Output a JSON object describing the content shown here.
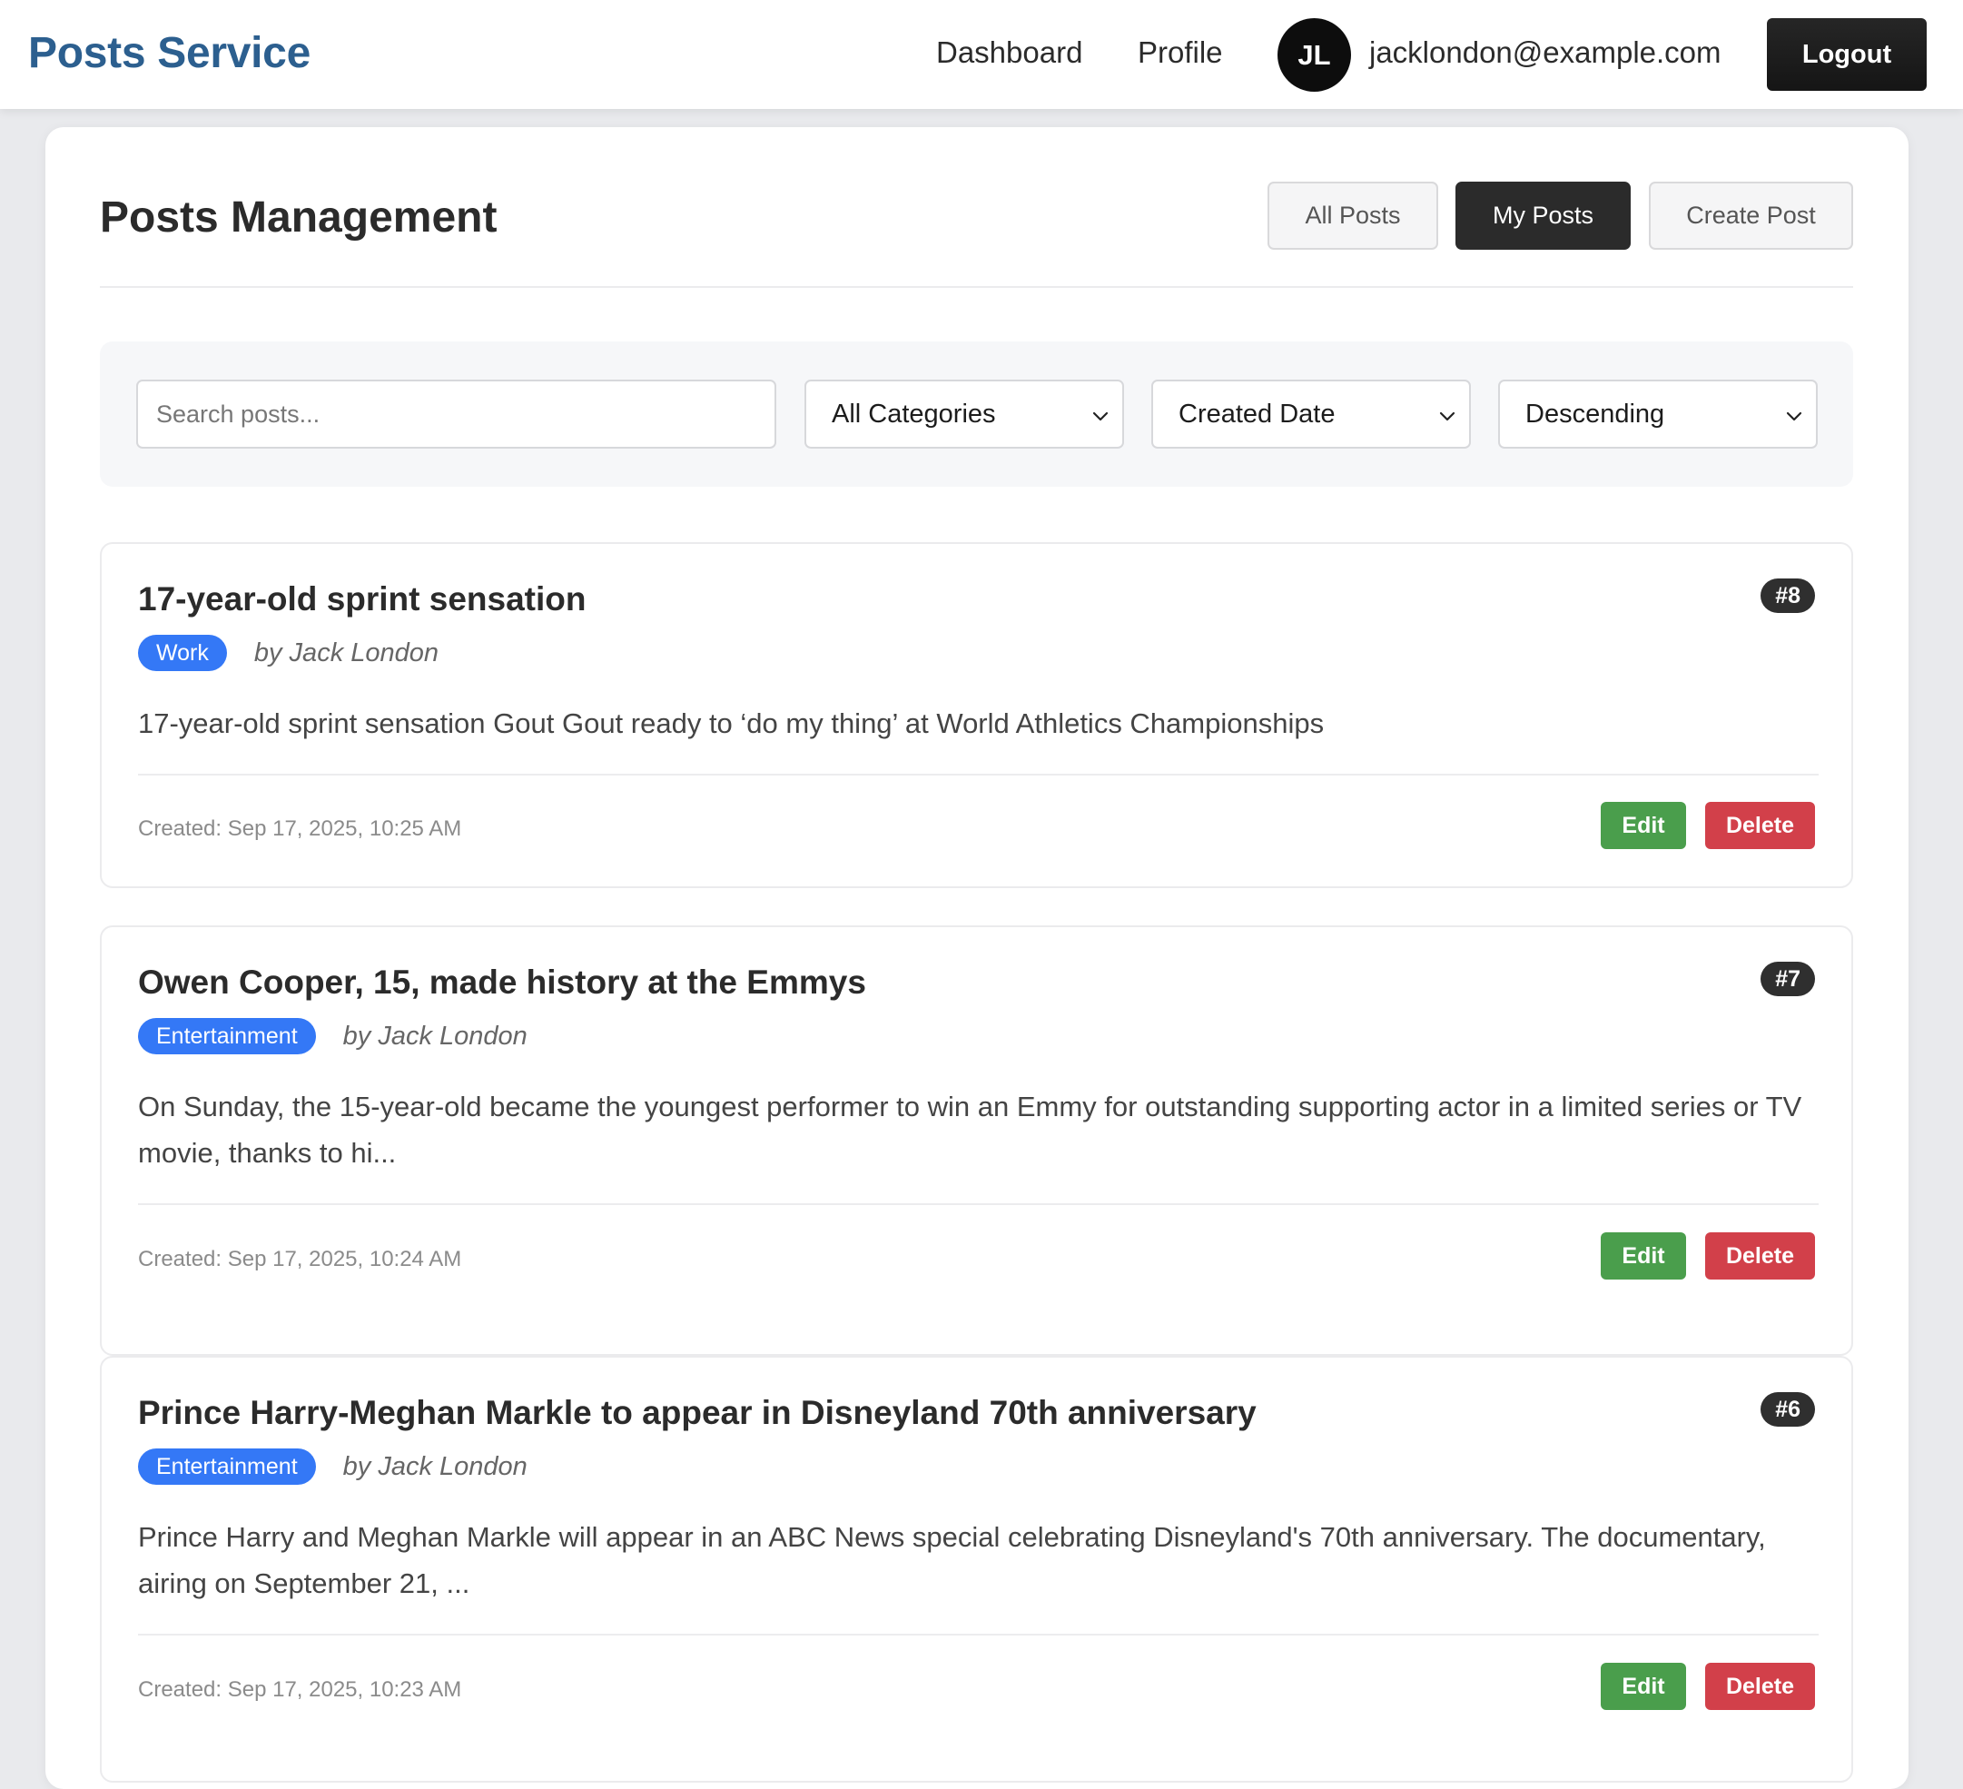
{
  "header": {
    "brand": "Posts Service",
    "nav": {
      "dashboard": "Dashboard",
      "profile": "Profile"
    },
    "user": {
      "initials": "JL",
      "email": "jacklondon@example.com"
    },
    "logout_label": "Logout"
  },
  "main": {
    "title": "Posts Management",
    "tabs": {
      "all": "All Posts",
      "mine": "My Posts",
      "create": "Create Post",
      "active": "My Posts"
    }
  },
  "filters": {
    "search_placeholder": "Search posts...",
    "search_value": "",
    "category": "All Categories",
    "sort_by": "Created Date",
    "order": "Descending"
  },
  "posts": [
    {
      "id": "#8",
      "title": "17-year-old sprint sensation",
      "category": "Work",
      "author": "by Jack London",
      "excerpt": "17-year-old sprint sensation Gout Gout ready to ‘do my thing’ at World Athletics Championships",
      "created": "Created: Sep 17, 2025, 10:25 AM",
      "edit_label": "Edit",
      "delete_label": "Delete"
    },
    {
      "id": "#7",
      "title": "Owen Cooper, 15, made history at the Emmys",
      "category": "Entertainment",
      "author": "by Jack London",
      "excerpt": "On Sunday, the 15-year-old became the youngest performer to win an Emmy for outstanding supporting actor in a limited series or TV movie, thanks to hi...",
      "created": "Created: Sep 17, 2025, 10:24 AM",
      "edit_label": "Edit",
      "delete_label": "Delete"
    },
    {
      "id": "#6",
      "title": "Prince Harry-Meghan Markle to appear in Disneyland 70th anniversary",
      "category": "Entertainment",
      "author": "by Jack London",
      "excerpt": "Prince Harry and Meghan Markle will appear in an ABC News special celebrating Disneyland's 70th anniversary. The documentary, airing on September 21, ...",
      "created": "Created: Sep 17, 2025, 10:23 AM",
      "edit_label": "Edit",
      "delete_label": "Delete"
    }
  ],
  "colors": {
    "brand": "#2c5f8f",
    "category_badge": "#3478f6",
    "edit": "#4a9e4c",
    "delete": "#d2404a",
    "active_tab": "#2b2b2b"
  },
  "icons": {
    "select_arrow": "chevron-down-icon"
  }
}
